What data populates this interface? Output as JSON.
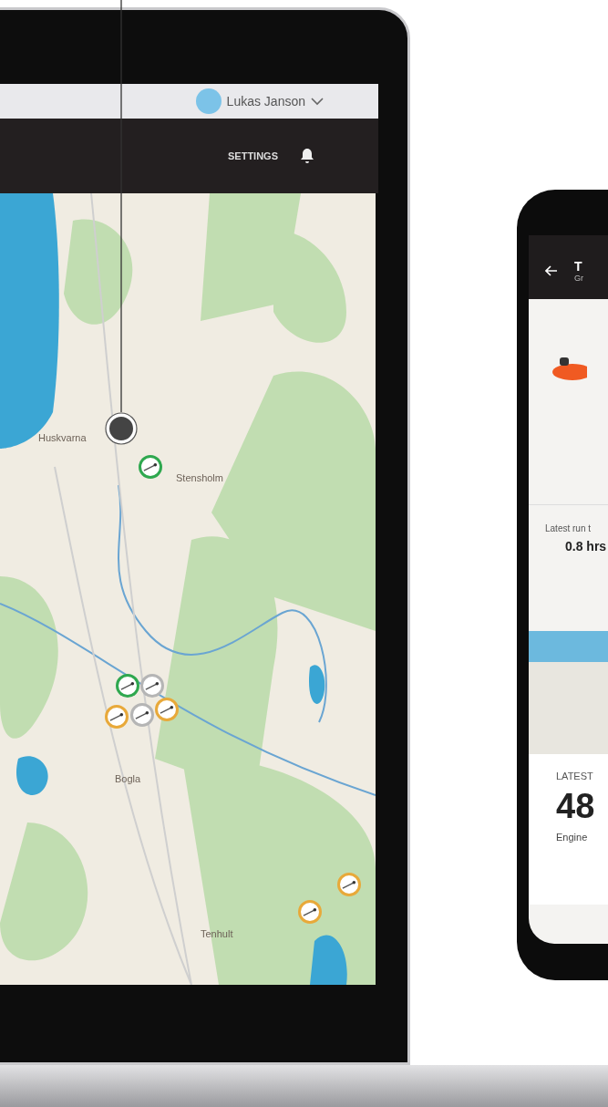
{
  "user_menu": {
    "name": "Lukas Janson"
  },
  "nav": {
    "settings": "SETTINGS"
  },
  "map": {
    "places": [
      "Huskvarna",
      "Stensholm",
      "Bogla",
      "Tenhult"
    ],
    "markers": [
      {
        "color": "#2fa84f"
      },
      {
        "color": "#2fa84f"
      },
      {
        "color": "#b5b5b5"
      },
      {
        "color": "#e8a93a"
      },
      {
        "color": "#b5b5b5"
      },
      {
        "color": "#e8a93a"
      },
      {
        "color": "#e8a93a"
      },
      {
        "color": "#e8a93a"
      }
    ]
  },
  "phone": {
    "title": "T",
    "subtitle": "Gr",
    "run_label": "Latest run t",
    "run_value": "0.8 hrs",
    "latest_label": "LATEST",
    "latest_value": "48",
    "engine_label": "Engine"
  }
}
